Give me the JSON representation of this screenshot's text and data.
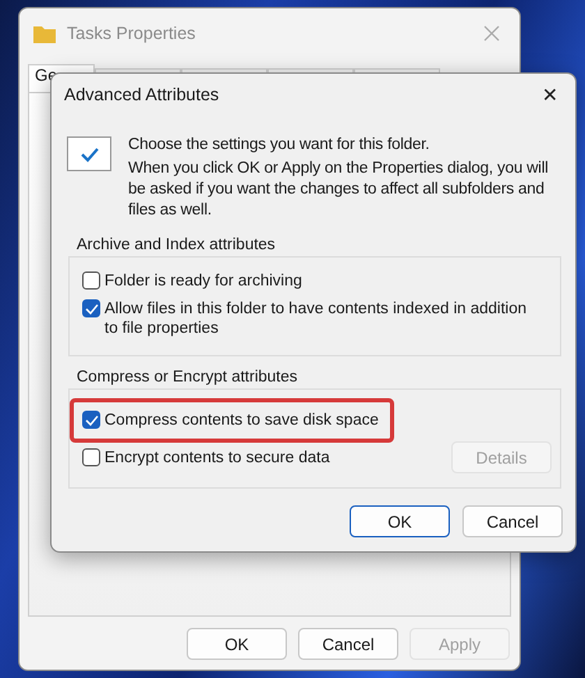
{
  "back_window": {
    "title": "Tasks Properties",
    "tabs": [
      {
        "label": "Ge",
        "selected": true
      }
    ],
    "buttons": [
      {
        "label": "OK",
        "disabled": false
      },
      {
        "label": "Cancel",
        "disabled": false
      },
      {
        "label": "Apply",
        "disabled": true
      }
    ]
  },
  "dialog": {
    "title": "Advanced Attributes",
    "close": "✕",
    "intro": "Choose the settings you want for this folder.",
    "description": "When you click OK or Apply on the Properties dialog, you will be asked if you want the changes to affect all subfolders and files as well.",
    "groups": [
      {
        "title": "Archive and Index attributes",
        "options": [
          {
            "label": "Folder is ready for archiving",
            "checked": false,
            "highlighted": false
          },
          {
            "label": "Allow files in this folder to have contents indexed in addition to file properties",
            "checked": true,
            "highlighted": false
          }
        ]
      },
      {
        "title": "Compress or Encrypt attributes",
        "options": [
          {
            "label": "Compress contents to save disk space",
            "checked": true,
            "highlighted": true
          },
          {
            "label": "Encrypt contents to secure data",
            "checked": false,
            "highlighted": false
          }
        ],
        "side_button": {
          "label": "Details",
          "disabled": true
        }
      }
    ],
    "buttons": [
      {
        "label": "OK",
        "default": true
      },
      {
        "label": "Cancel",
        "default": false
      }
    ]
  }
}
